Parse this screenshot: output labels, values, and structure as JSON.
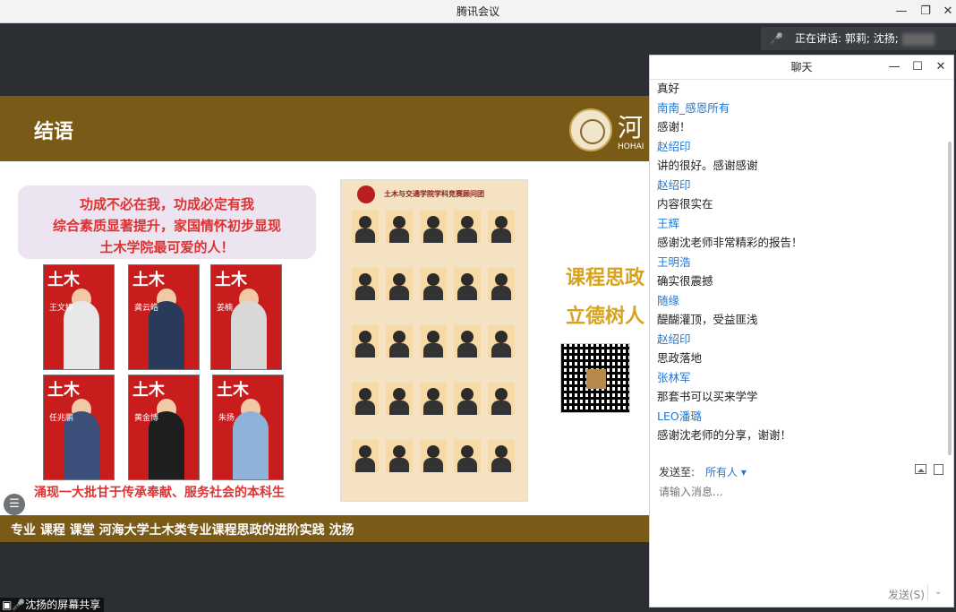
{
  "window": {
    "title": "腾讯会议"
  },
  "speaking": {
    "label": "正在讲话: 郭莉; 沈扬;"
  },
  "slide": {
    "header_title": "结语",
    "logo_text": "河",
    "logo_sub": "HOHAI",
    "slogans": [
      "功成不必在我，功成必定有我",
      "综合素质显著提升，家国情怀初步显现",
      "土木学院最可爱的人！"
    ],
    "covers": [
      {
        "title": "土木",
        "name": "王文婷"
      },
      {
        "title": "土木",
        "name": "龚云皓"
      },
      {
        "title": "土木",
        "name": "姜楠"
      },
      {
        "title": "土木",
        "name": "任兆鹏"
      },
      {
        "title": "土木",
        "name": "黄金博"
      },
      {
        "title": "土木",
        "name": "朱扬"
      }
    ],
    "bottom_slogan": "涌现一大批甘于传承奉献、服务社会的本科生",
    "poster_title": "土木与交通学院学科竞赛顾问团",
    "gold_lines": [
      "课程思政",
      "立德树人"
    ],
    "footer": "专业 课程 课堂 河海大学土木类专业课程思政的进阶实践   沈扬"
  },
  "share_label": "沈扬的屏幕共享",
  "chat": {
    "title": "聊天",
    "messages": [
      {
        "type": "text",
        "text": "真好"
      },
      {
        "type": "sender",
        "text": "南南_感恩所有"
      },
      {
        "type": "text",
        "text": "感谢！"
      },
      {
        "type": "sender",
        "text": "赵绍印"
      },
      {
        "type": "text",
        "text": "讲的很好。感谢感谢"
      },
      {
        "type": "sender",
        "text": "赵绍印"
      },
      {
        "type": "text",
        "text": "内容很实在"
      },
      {
        "type": "sender",
        "text": "王辉"
      },
      {
        "type": "text",
        "text": "感谢沈老师非常精彩的报告！"
      },
      {
        "type": "sender",
        "text": "王明浩"
      },
      {
        "type": "text",
        "text": "确实很震撼"
      },
      {
        "type": "sender",
        "text": "随缘"
      },
      {
        "type": "text",
        "text": "醍醐灌顶，受益匪浅"
      },
      {
        "type": "sender",
        "text": "赵绍印"
      },
      {
        "type": "text",
        "text": "思政落地"
      },
      {
        "type": "sender",
        "text": "张林军"
      },
      {
        "type": "text",
        "text": "那套书可以买来学学"
      },
      {
        "type": "sender",
        "text": "LEO潘璐"
      },
      {
        "type": "text",
        "text": "感谢沈老师的分享，谢谢！"
      }
    ],
    "send_to_label": "发送至:",
    "send_to_value": "所有人 ▾",
    "input_placeholder": "请输入消息...",
    "send_button": "发送(S)"
  }
}
